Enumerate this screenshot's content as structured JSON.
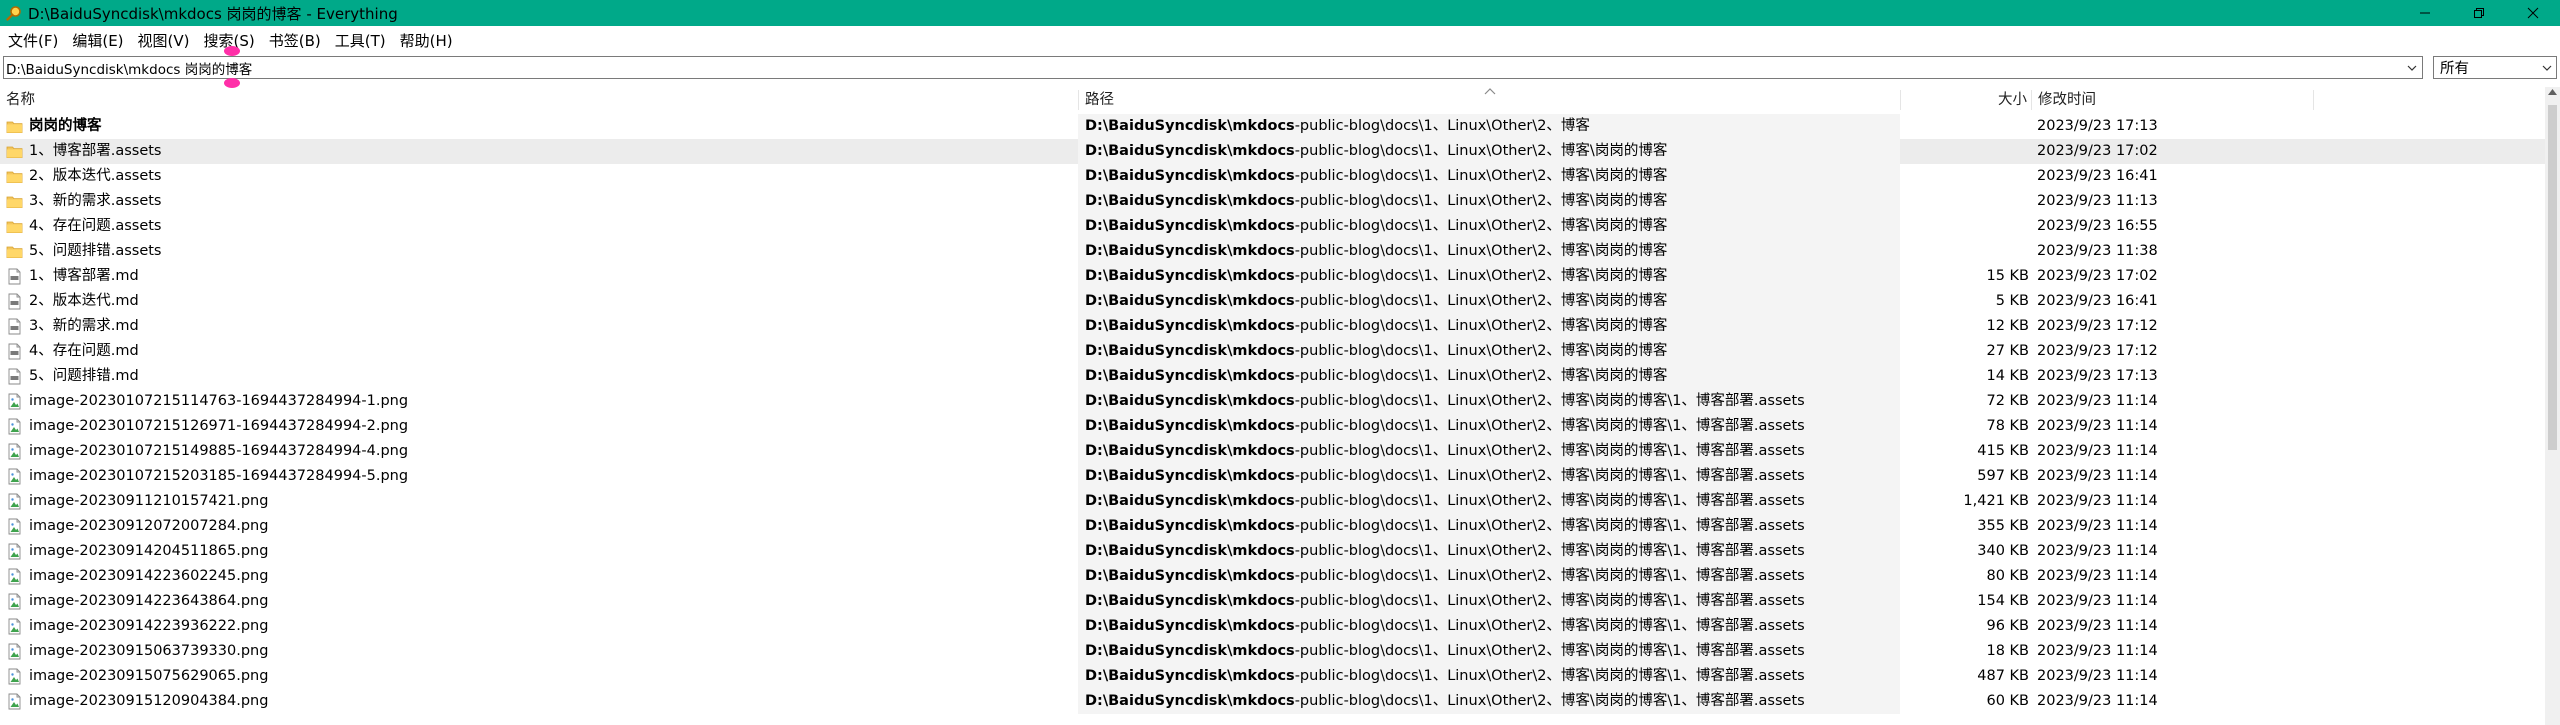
{
  "window": {
    "title": "D:\\BaiduSyncdisk\\mkdocs 岗岗的博客 - Everything",
    "icon": "magnifier-icon",
    "accent_color": "#00a989"
  },
  "menu": {
    "items": [
      "文件(F)",
      "编辑(E)",
      "视图(V)",
      "搜索(S)",
      "书签(B)",
      "工具(T)",
      "帮助(H)"
    ]
  },
  "search": {
    "value": "D:\\BaiduSyncdisk\\mkdocs 岗岗的博客",
    "filter": "所有"
  },
  "columns": {
    "name": "名称",
    "path": "路径",
    "size": "大小",
    "modified": "修改时间"
  },
  "rows": [
    {
      "type": "folder",
      "name": "岗岗的博客",
      "path_bold": "D:\\BaiduSyncdisk\\mkdocs",
      "path_rest": "-public-blog\\docs\\1、Linux\\Other\\2、博客",
      "size": "",
      "date": "2023/9/23 17:13",
      "bold": true
    },
    {
      "type": "folder",
      "name": "1、博客部署.assets",
      "path_bold": "D:\\BaiduSyncdisk\\mkdocs",
      "path_rest": "-public-blog\\docs\\1、Linux\\Other\\2、博客\\岗岗的博客",
      "size": "",
      "date": "2023/9/23 17:02",
      "selected": true
    },
    {
      "type": "folder",
      "name": "2、版本迭代.assets",
      "path_bold": "D:\\BaiduSyncdisk\\mkdocs",
      "path_rest": "-public-blog\\docs\\1、Linux\\Other\\2、博客\\岗岗的博客",
      "size": "",
      "date": "2023/9/23 16:41"
    },
    {
      "type": "folder",
      "name": "3、新的需求.assets",
      "path_bold": "D:\\BaiduSyncdisk\\mkdocs",
      "path_rest": "-public-blog\\docs\\1、Linux\\Other\\2、博客\\岗岗的博客",
      "size": "",
      "date": "2023/9/23 11:13"
    },
    {
      "type": "folder",
      "name": "4、存在问题.assets",
      "path_bold": "D:\\BaiduSyncdisk\\mkdocs",
      "path_rest": "-public-blog\\docs\\1、Linux\\Other\\2、博客\\岗岗的博客",
      "size": "",
      "date": "2023/9/23 16:55"
    },
    {
      "type": "folder",
      "name": "5、问题排错.assets",
      "path_bold": "D:\\BaiduSyncdisk\\mkdocs",
      "path_rest": "-public-blog\\docs\\1、Linux\\Other\\2、博客\\岗岗的博客",
      "size": "",
      "date": "2023/9/23 11:38"
    },
    {
      "type": "md",
      "name": "1、博客部署.md",
      "path_bold": "D:\\BaiduSyncdisk\\mkdocs",
      "path_rest": "-public-blog\\docs\\1、Linux\\Other\\2、博客\\岗岗的博客",
      "size": "15 KB",
      "date": "2023/9/23 17:02"
    },
    {
      "type": "md",
      "name": "2、版本迭代.md",
      "path_bold": "D:\\BaiduSyncdisk\\mkdocs",
      "path_rest": "-public-blog\\docs\\1、Linux\\Other\\2、博客\\岗岗的博客",
      "size": "5 KB",
      "date": "2023/9/23 16:41"
    },
    {
      "type": "md",
      "name": "3、新的需求.md",
      "path_bold": "D:\\BaiduSyncdisk\\mkdocs",
      "path_rest": "-public-blog\\docs\\1、Linux\\Other\\2、博客\\岗岗的博客",
      "size": "12 KB",
      "date": "2023/9/23 17:12"
    },
    {
      "type": "md",
      "name": "4、存在问题.md",
      "path_bold": "D:\\BaiduSyncdisk\\mkdocs",
      "path_rest": "-public-blog\\docs\\1、Linux\\Other\\2、博客\\岗岗的博客",
      "size": "27 KB",
      "date": "2023/9/23 17:12"
    },
    {
      "type": "md",
      "name": "5、问题排错.md",
      "path_bold": "D:\\BaiduSyncdisk\\mkdocs",
      "path_rest": "-public-blog\\docs\\1、Linux\\Other\\2、博客\\岗岗的博客",
      "size": "14 KB",
      "date": "2023/9/23 17:13"
    },
    {
      "type": "png",
      "name": "image-20230107215114763-1694437284994-1.png",
      "path_bold": "D:\\BaiduSyncdisk\\mkdocs",
      "path_rest": "-public-blog\\docs\\1、Linux\\Other\\2、博客\\岗岗的博客\\1、博客部署.assets",
      "size": "72 KB",
      "date": "2023/9/23 11:14"
    },
    {
      "type": "png",
      "name": "image-20230107215126971-1694437284994-2.png",
      "path_bold": "D:\\BaiduSyncdisk\\mkdocs",
      "path_rest": "-public-blog\\docs\\1、Linux\\Other\\2、博客\\岗岗的博客\\1、博客部署.assets",
      "size": "78 KB",
      "date": "2023/9/23 11:14"
    },
    {
      "type": "png",
      "name": "image-20230107215149885-1694437284994-4.png",
      "path_bold": "D:\\BaiduSyncdisk\\mkdocs",
      "path_rest": "-public-blog\\docs\\1、Linux\\Other\\2、博客\\岗岗的博客\\1、博客部署.assets",
      "size": "415 KB",
      "date": "2023/9/23 11:14"
    },
    {
      "type": "png",
      "name": "image-20230107215203185-1694437284994-5.png",
      "path_bold": "D:\\BaiduSyncdisk\\mkdocs",
      "path_rest": "-public-blog\\docs\\1、Linux\\Other\\2、博客\\岗岗的博客\\1、博客部署.assets",
      "size": "597 KB",
      "date": "2023/9/23 11:14"
    },
    {
      "type": "png",
      "name": "image-20230911210157421.png",
      "path_bold": "D:\\BaiduSyncdisk\\mkdocs",
      "path_rest": "-public-blog\\docs\\1、Linux\\Other\\2、博客\\岗岗的博客\\1、博客部署.assets",
      "size": "1,421 KB",
      "date": "2023/9/23 11:14"
    },
    {
      "type": "png",
      "name": "image-20230912072007284.png",
      "path_bold": "D:\\BaiduSyncdisk\\mkdocs",
      "path_rest": "-public-blog\\docs\\1、Linux\\Other\\2、博客\\岗岗的博客\\1、博客部署.assets",
      "size": "355 KB",
      "date": "2023/9/23 11:14"
    },
    {
      "type": "png",
      "name": "image-20230914204511865.png",
      "path_bold": "D:\\BaiduSyncdisk\\mkdocs",
      "path_rest": "-public-blog\\docs\\1、Linux\\Other\\2、博客\\岗岗的博客\\1、博客部署.assets",
      "size": "340 KB",
      "date": "2023/9/23 11:14"
    },
    {
      "type": "png",
      "name": "image-20230914223602245.png",
      "path_bold": "D:\\BaiduSyncdisk\\mkdocs",
      "path_rest": "-public-blog\\docs\\1、Linux\\Other\\2、博客\\岗岗的博客\\1、博客部署.assets",
      "size": "80 KB",
      "date": "2023/9/23 11:14"
    },
    {
      "type": "png",
      "name": "image-20230914223643864.png",
      "path_bold": "D:\\BaiduSyncdisk\\mkdocs",
      "path_rest": "-public-blog\\docs\\1、Linux\\Other\\2、博客\\岗岗的博客\\1、博客部署.assets",
      "size": "154 KB",
      "date": "2023/9/23 11:14"
    },
    {
      "type": "png",
      "name": "image-20230914223936222.png",
      "path_bold": "D:\\BaiduSyncdisk\\mkdocs",
      "path_rest": "-public-blog\\docs\\1、Linux\\Other\\2、博客\\岗岗的博客\\1、博客部署.assets",
      "size": "96 KB",
      "date": "2023/9/23 11:14"
    },
    {
      "type": "png",
      "name": "image-20230915063739330.png",
      "path_bold": "D:\\BaiduSyncdisk\\mkdocs",
      "path_rest": "-public-blog\\docs\\1、Linux\\Other\\2、博客\\岗岗的博客\\1、博客部署.assets",
      "size": "18 KB",
      "date": "2023/9/23 11:14"
    },
    {
      "type": "png",
      "name": "image-20230915075629065.png",
      "path_bold": "D:\\BaiduSyncdisk\\mkdocs",
      "path_rest": "-public-blog\\docs\\1、Linux\\Other\\2、博客\\岗岗的博客\\1、博客部署.assets",
      "size": "487 KB",
      "date": "2023/9/23 11:14"
    },
    {
      "type": "png",
      "name": "image-20230915120904384.png",
      "path_bold": "D:\\BaiduSyncdisk\\mkdocs",
      "path_rest": "-public-blog\\docs\\1、Linux\\Other\\2、博客\\岗岗的博客\\1、博客部署.assets",
      "size": "60 KB",
      "date": "2023/9/23 11:14"
    }
  ]
}
